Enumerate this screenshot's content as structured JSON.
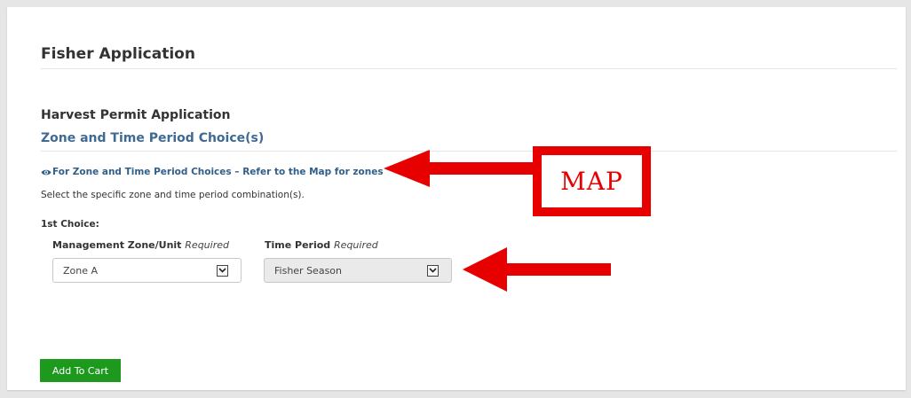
{
  "app": {
    "title": "Fisher Application"
  },
  "section": {
    "title": "Harvest Permit Application",
    "subtitle": "Zone and Time Period Choice(s)",
    "map_link": "For Zone and Time Period Choices – Refer to the Map for zones",
    "instruction": "Select the specific zone and time period combination(s).",
    "choice_label": "1st Choice:"
  },
  "fields": {
    "zone": {
      "label": "Management Zone/Unit",
      "required": "Required",
      "value": "Zone A"
    },
    "time": {
      "label": "Time Period",
      "required": "Required",
      "value": "Fisher Season"
    }
  },
  "actions": {
    "add_to_cart": "Add To Cart"
  },
  "annotations": {
    "map_label": "MAP",
    "color": "#e60000"
  },
  "colors": {
    "link": "#3f6a93",
    "button": "#1d9a1d",
    "background": "#e6e6e6"
  },
  "icons": {
    "map_link": "eye-icon",
    "select": "chevron-down-icon"
  }
}
